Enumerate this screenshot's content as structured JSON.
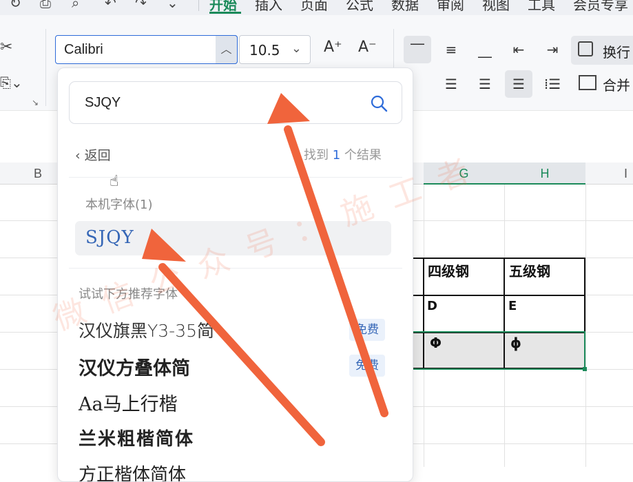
{
  "menu": {
    "tabs": [
      "开始",
      "插入",
      "页面",
      "公式",
      "数据",
      "审阅",
      "视图",
      "工具",
      "会员专享"
    ],
    "active_tab": "开始"
  },
  "ribbon": {
    "font_name": "Calibri",
    "font_size": "10.5",
    "increase_font_glyph": "A⁺",
    "decrease_font_glyph": "A⁻",
    "wrap_label": "换行",
    "merge_label": "合并"
  },
  "sheet": {
    "columns": [
      "B",
      "G",
      "H",
      "I"
    ],
    "selected_columns": [
      "G",
      "H"
    ],
    "cells": {
      "g_header": "四级钢",
      "h_header": "五级钢",
      "g_code": "D",
      "h_code": "E",
      "g_symbol": "Φ",
      "h_symbol": "ɸ"
    }
  },
  "font_dropdown": {
    "search_value": "SJQY",
    "back_label": "返回",
    "result_prefix": "找到",
    "result_count": "1",
    "result_suffix": "个结果",
    "local_group_label": "本机字体(1)",
    "local_fonts": [
      "SJQY"
    ],
    "recommend_label": "试试下方推荐字体",
    "recommended": [
      {
        "name": "汉仪旗黑Y3-35简",
        "badge": "免费"
      },
      {
        "name": "汉仪方叠体简",
        "badge": "免费"
      },
      {
        "name": "Aa马上行楷",
        "badge": ""
      },
      {
        "name": "兰米粗楷简体",
        "badge": ""
      },
      {
        "name": "方正楷体简体",
        "badge": ""
      }
    ]
  },
  "watermark_text": "微信公众号：施工者",
  "colors": {
    "accent_green": "#1b8a5a",
    "accent_blue": "#2d6bd9",
    "arrow_orange": "#f0643c"
  }
}
